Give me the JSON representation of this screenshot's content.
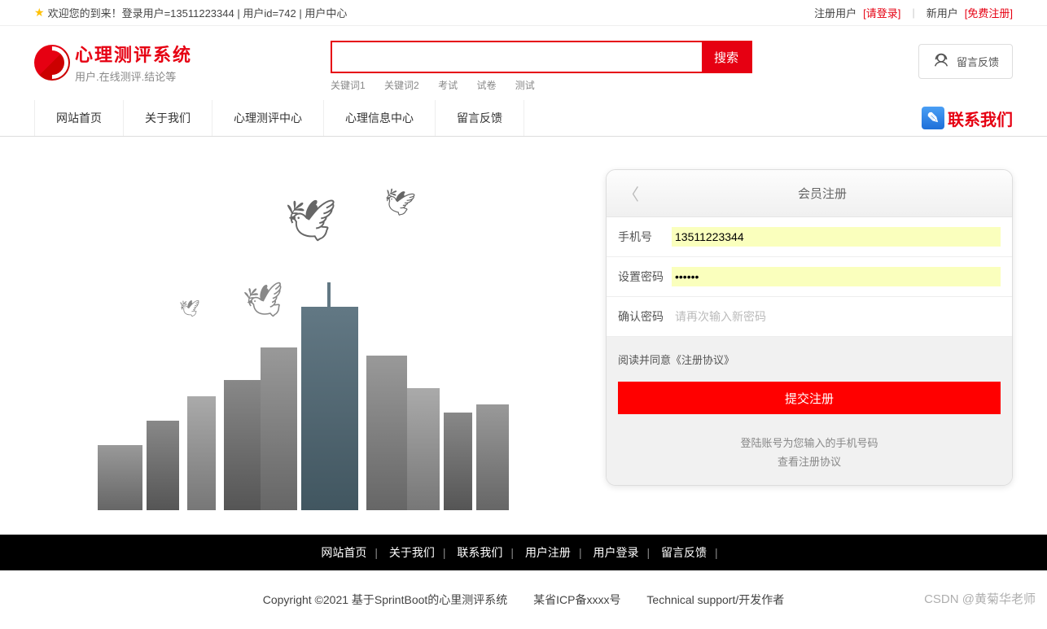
{
  "topbar": {
    "welcome": "欢迎您的到来！登录用户=13511223344 | 用户id=742 | 用户中心",
    "registered_user": "注册用户",
    "please_login": "[请登录]",
    "new_user": "新用户",
    "free_register": "[免费注册]"
  },
  "header": {
    "logo_title": "心理测评系统",
    "logo_subtitle": "用户.在线测评.结论等",
    "search_btn": "搜索",
    "keywords": [
      "关键词1",
      "关键词2",
      "考试",
      "试卷",
      "测试"
    ],
    "feedback_btn": "留言反馈"
  },
  "nav": {
    "items": [
      "网站首页",
      "关于我们",
      "心理测评中心",
      "心理信息中心",
      "留言反馈"
    ],
    "contact_label": "联系我们"
  },
  "register": {
    "title": "会员注册",
    "fields": {
      "phone_label": "手机号",
      "phone_value": "13511223344",
      "pwd_label": "设置密码",
      "pwd_value": "••••••",
      "confirm_label": "确认密码",
      "confirm_placeholder": "请再次输入新密码"
    },
    "agreement": "阅读并同意《注册协议》",
    "submit": "提交注册",
    "hint1": "登陆账号为您输入的手机号码",
    "hint2": "查看注册协议"
  },
  "footer_nav": {
    "items": [
      "网站首页",
      "关于我们",
      "联系我们",
      "用户注册",
      "用户登录",
      "留言反馈"
    ]
  },
  "copyright": {
    "text1": "Copyright ©2021 基于SprintBoot的心里测评系统",
    "text2": "某省ICP备xxxx号",
    "text3": "Technical support/开发作者"
  },
  "watermark": "CSDN @黄菊华老师"
}
